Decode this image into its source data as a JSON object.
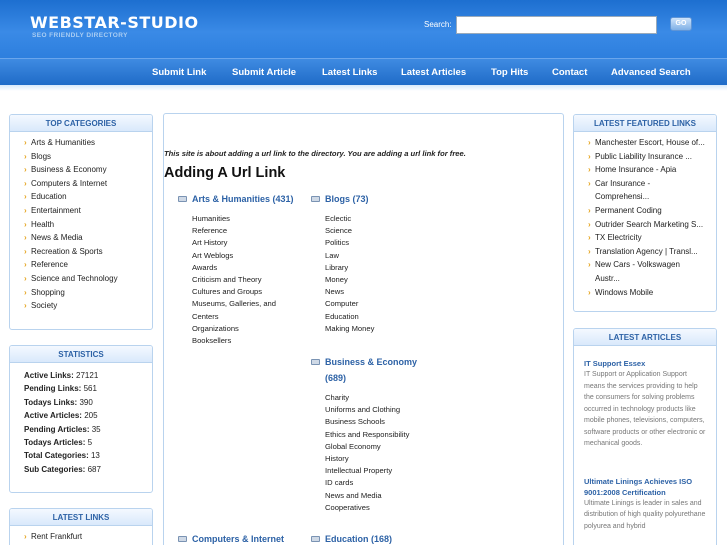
{
  "header": {
    "logo": "WEBSTAR-STUDIO",
    "tagline": "SEO FRIENDLY DIRECTORY",
    "search_label": "Search:",
    "search_value": "",
    "go_label": "GO"
  },
  "nav": [
    "Submit Link",
    "Submit Article",
    "Latest Links",
    "Latest Articles",
    "Top Hits",
    "Contact",
    "Advanced Search"
  ],
  "top_categories": {
    "title": "TOP CATEGORIES",
    "items": [
      "Arts & Humanities",
      "Blogs",
      "Business & Economy",
      "Computers & Internet",
      "Education",
      "Entertainment",
      "Health",
      "News & Media",
      "Recreation & Sports",
      "Reference",
      "Science and Technology",
      "Shopping",
      "Society"
    ]
  },
  "statistics": {
    "title": "STATISTICS",
    "rows": [
      {
        "label": "Active Links:",
        "value": "27121"
      },
      {
        "label": "Pending Links:",
        "value": "561"
      },
      {
        "label": "Todays Links:",
        "value": "390"
      },
      {
        "label": "Active Articles:",
        "value": "205"
      },
      {
        "label": "Pending Articles:",
        "value": "35"
      },
      {
        "label": "Todays Articles:",
        "value": "5"
      },
      {
        "label": "Total Categories:",
        "value": "13"
      },
      {
        "label": "Sub Categories:",
        "value": "687"
      }
    ]
  },
  "latest_links": {
    "title": "LATEST LINKS",
    "items": [
      "Rent Frankfurt"
    ]
  },
  "main": {
    "intro": "This site is about adding a url link to the directory. You are adding a url link for free.",
    "title": "Adding A Url Link",
    "categories": [
      {
        "name": "Arts & Humanities (431)",
        "subs": [
          "Humanities",
          "Reference",
          "Art History",
          "Art Weblogs",
          "Awards",
          "Criticism and Theory",
          "Cultures and Groups",
          "Museums, Galleries, and Centers",
          "Organizations",
          "Booksellers"
        ]
      },
      {
        "name": "Blogs (73)",
        "subs": [
          "Eclectic",
          "Science",
          "Politics",
          "Law",
          "Library",
          "Money",
          "News",
          "Computer",
          "Education",
          "Making Money"
        ]
      },
      {
        "name": "Business & Economy (689)",
        "subs": [
          "Charity",
          "Uniforms and Clothing",
          "Business Schools",
          "Ethics and Responsibility",
          "Global Economy",
          "History",
          "Intellectual Property",
          "ID cards",
          "News and Media",
          "Cooperatives"
        ]
      },
      {
        "name": "Computers & Internet",
        "subs": []
      },
      {
        "name": "Education (168)",
        "subs": []
      }
    ]
  },
  "featured_links": {
    "title": "LATEST FEATURED LINKS",
    "items": [
      "Manchester Escort, House of...",
      "Public Liability Insurance ...",
      "Home Insurance - Apia",
      "Car Insurance - Comprehensi...",
      "Permanent Coding",
      "Outrider Search Marketing S...",
      "TX Electricity",
      "Translation Agency | Transl...",
      "New Cars - Volkswagen Austr...",
      "Windows Mobile"
    ]
  },
  "latest_articles": {
    "title": "LATEST ARTICLES",
    "items": [
      {
        "title": "IT Support Essex",
        "body": "IT Support or Application Support means the services providing to help the consumers for solving problems occurred in technology products like mobile phones, televisions, computers, software products or other electronic or mechanical goods."
      },
      {
        "title": "Ultimate Linings Achieves ISO 9001:2008 Certification",
        "body": "Ultimate Linings is leader in sales and distribution of high quality polyurethane polyurea and hybrid"
      }
    ]
  },
  "colors": {
    "accent": "#2d62a6",
    "header": "#1d6fd0",
    "bullet": "#e5a31b"
  }
}
